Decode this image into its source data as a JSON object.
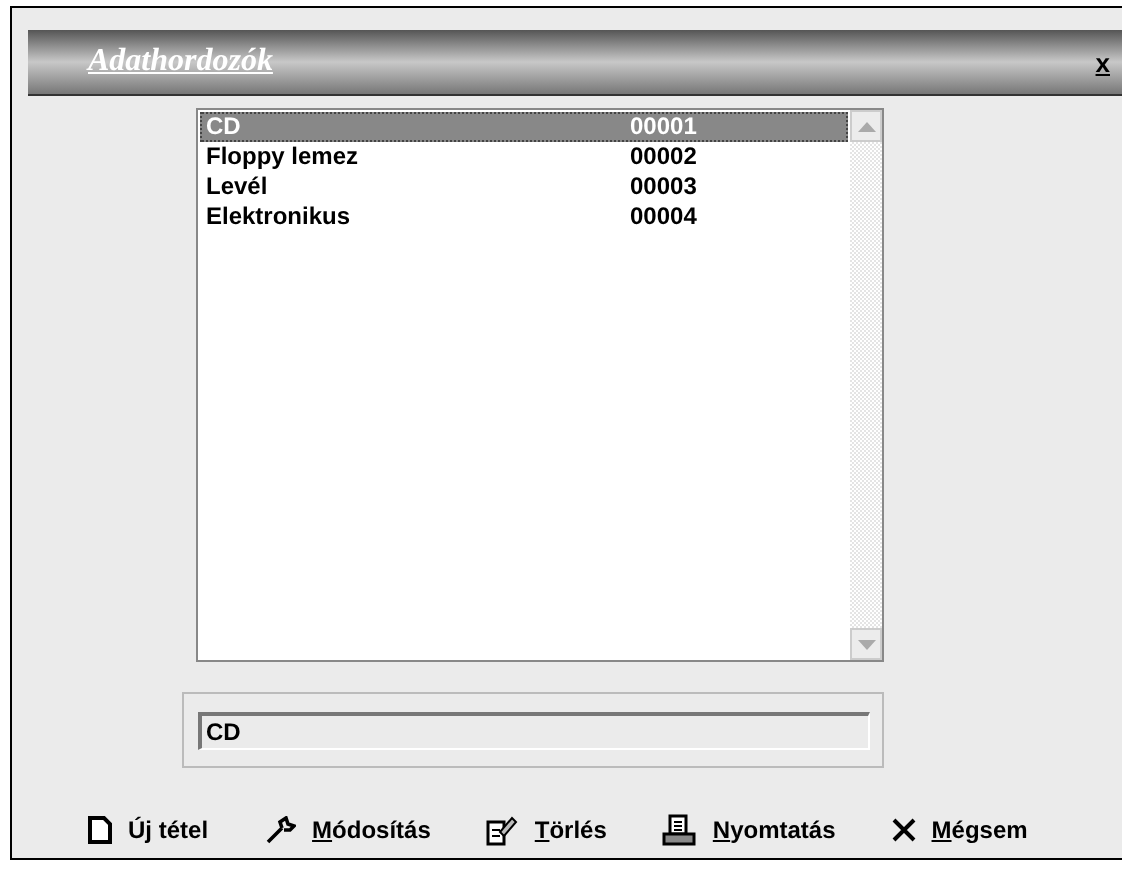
{
  "window": {
    "title": "Adathordozók",
    "close": "x"
  },
  "list": {
    "rows": [
      {
        "name": "CD",
        "code": "00001",
        "selected": true
      },
      {
        "name": "Floppy lemez",
        "code": "00002",
        "selected": false
      },
      {
        "name": "Levél",
        "code": "00003",
        "selected": false
      },
      {
        "name": "Elektronikus",
        "code": "00004",
        "selected": false
      }
    ]
  },
  "field": {
    "value": "CD"
  },
  "buttons": [
    {
      "kind": "new",
      "before": "Ú",
      "key": "j",
      "after": " tétel"
    },
    {
      "kind": "edit",
      "key": "M",
      "after": "ódosítás"
    },
    {
      "kind": "delete",
      "key": "T",
      "after": "örlés"
    },
    {
      "kind": "print",
      "key": "N",
      "after": "yomtatás"
    },
    {
      "kind": "cancel",
      "key": "M",
      "after": "égsem"
    }
  ]
}
